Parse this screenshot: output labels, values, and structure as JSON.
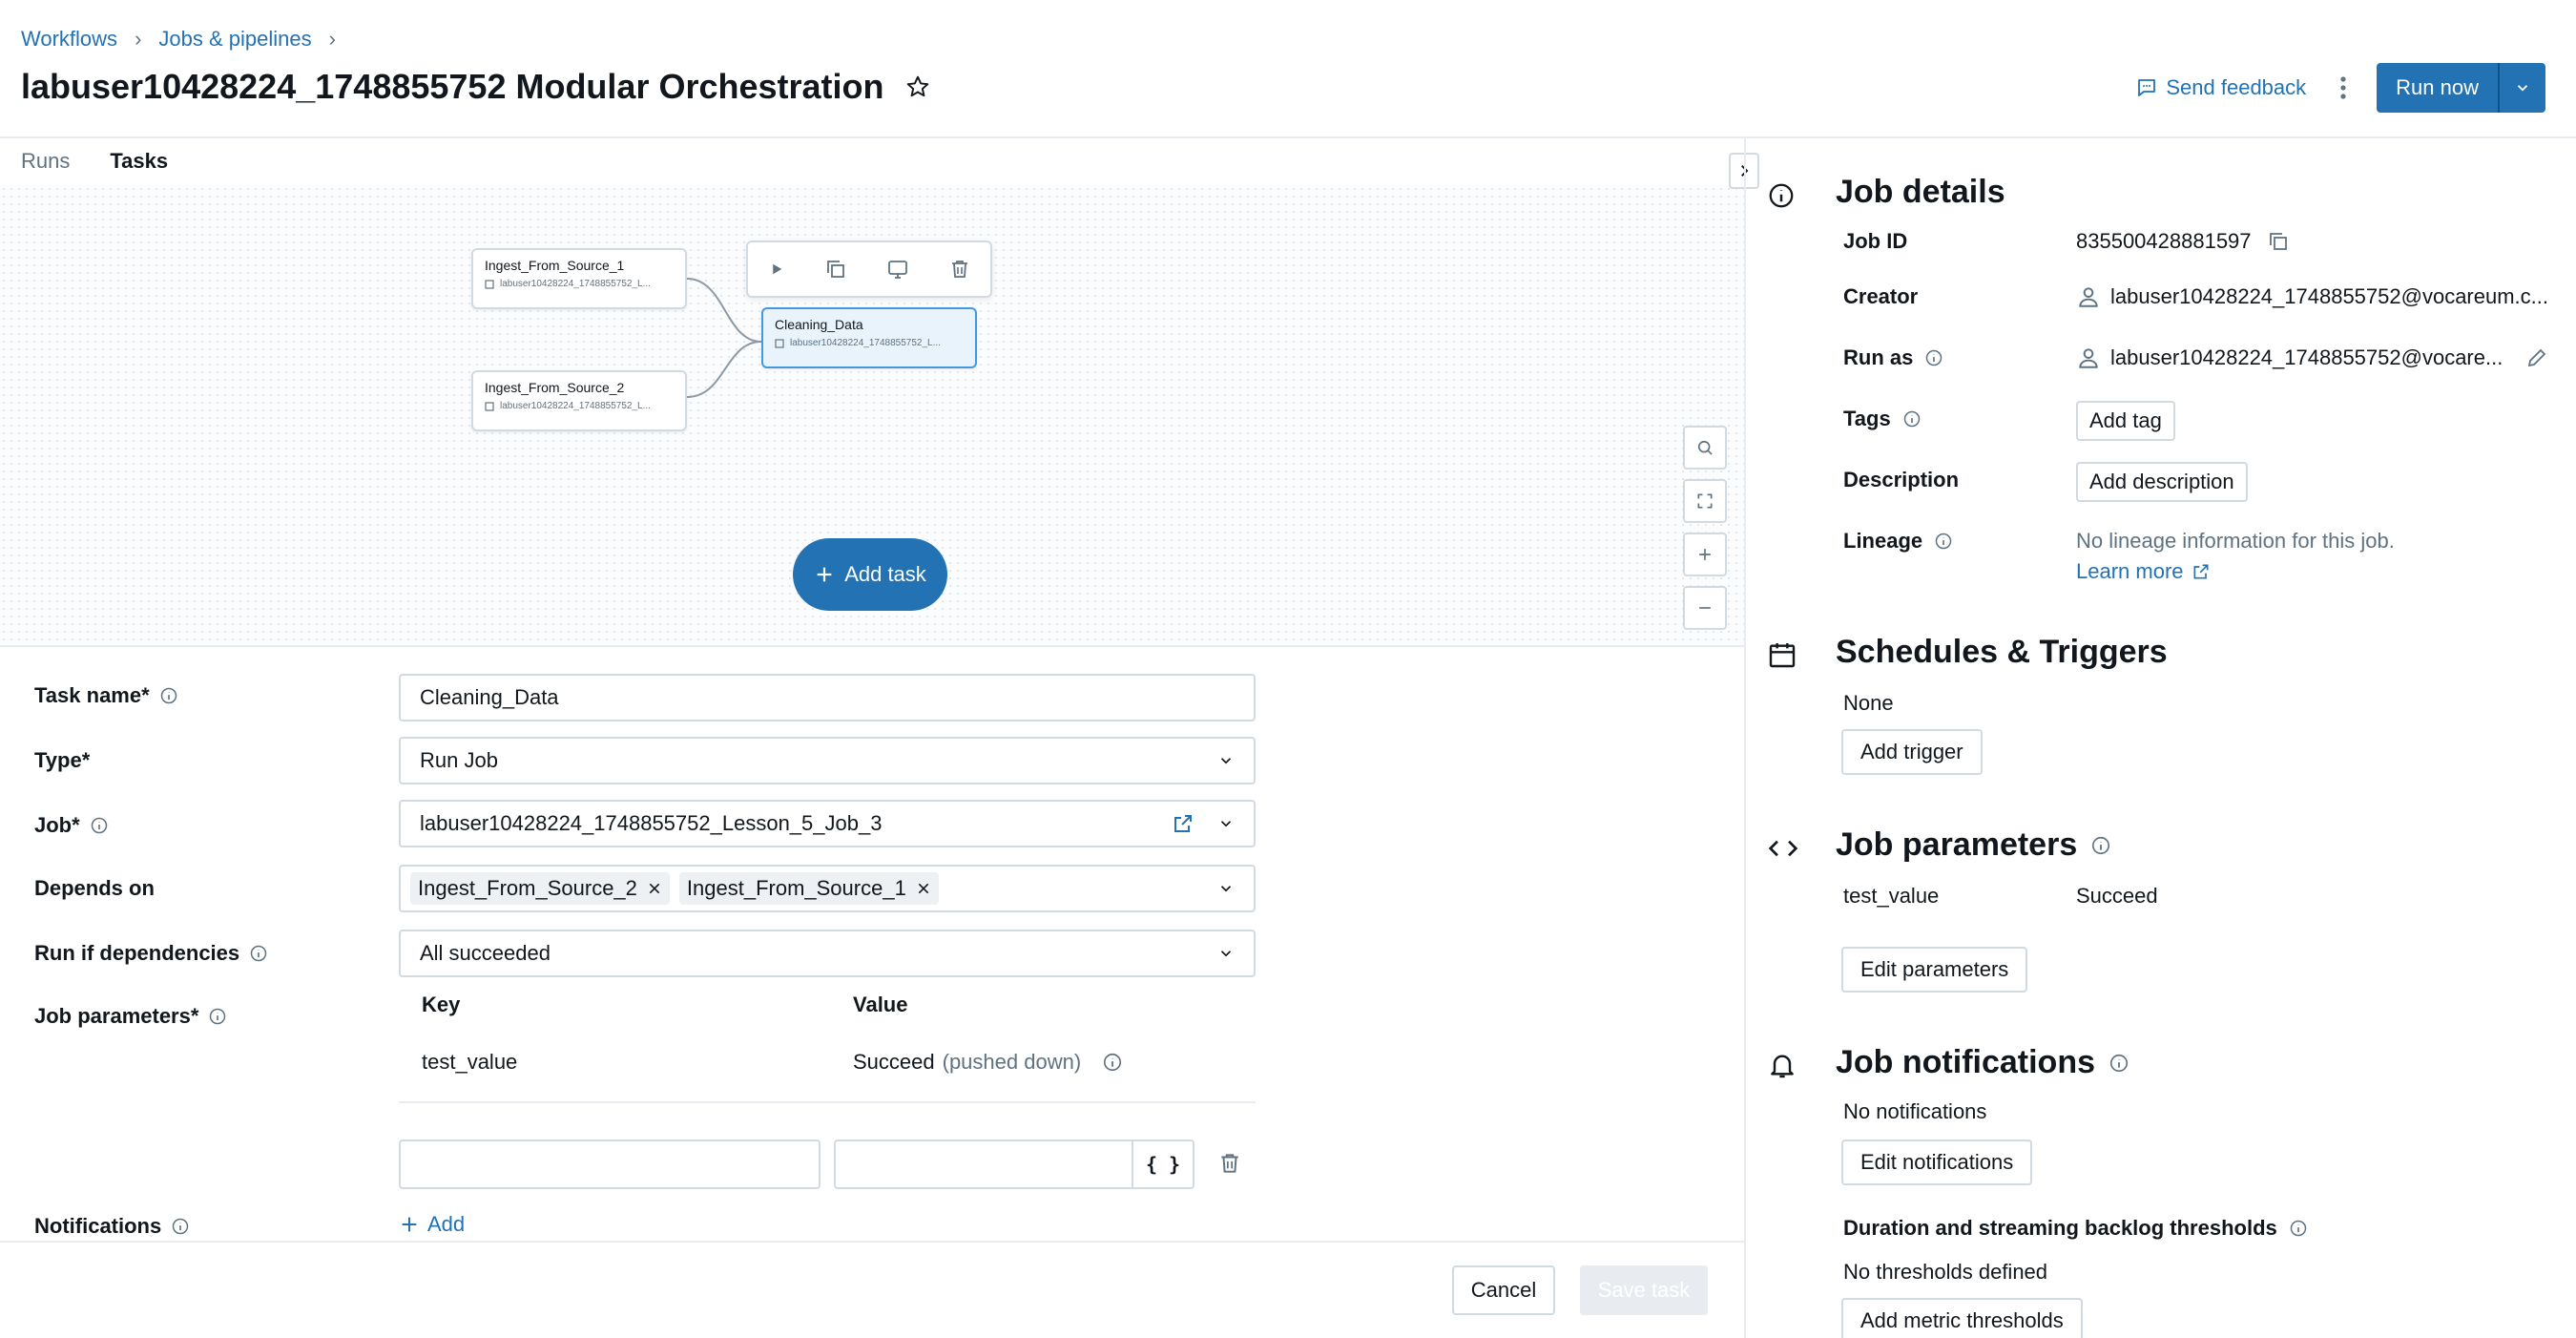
{
  "breadcrumb": {
    "items": [
      "Workflows",
      "Jobs & pipelines"
    ],
    "separator": "›"
  },
  "page": {
    "title": "labuser10428224_1748855752 Modular Orchestration"
  },
  "header": {
    "send_feedback": "Send feedback",
    "run_now": "Run now"
  },
  "tabs": [
    {
      "label": "Runs",
      "active": false
    },
    {
      "label": "Tasks",
      "active": true
    }
  ],
  "graph": {
    "nodes": [
      {
        "name": "Ingest_From_Source_1",
        "sub": "labuser10428224_1748855752_L..."
      },
      {
        "name": "Ingest_From_Source_2",
        "sub": "labuser10428224_1748855752_L..."
      },
      {
        "name": "Cleaning_Data",
        "sub": "labuser10428224_1748855752_L...",
        "selected": true
      }
    ],
    "add_task": "Add task"
  },
  "form": {
    "task_name_label": "Task name*",
    "task_name_value": "Cleaning_Data",
    "type_label": "Type*",
    "type_value": "Run Job",
    "job_label": "Job*",
    "job_value": "labuser10428224_1748855752_Lesson_5_Job_3",
    "depends_on_label": "Depends on",
    "depends_on": [
      "Ingest_From_Source_2",
      "Ingest_From_Source_1"
    ],
    "run_if_label": "Run if dependencies",
    "run_if_value": "All succeeded",
    "job_params_label": "Job parameters*",
    "params_key_header": "Key",
    "params_value_header": "Value",
    "params_rows": [
      {
        "key": "test_value",
        "value": "Succeed",
        "note": "(pushed down)"
      }
    ],
    "brace_label": "{ }",
    "notifications_label": "Notifications",
    "add_label": "Add",
    "cancel": "Cancel",
    "save": "Save task"
  },
  "details": {
    "heading": "Job details",
    "job_id_label": "Job ID",
    "job_id": "835500428881597",
    "creator_label": "Creator",
    "creator": "labuser10428224_1748855752@vocareum.c...",
    "run_as_label": "Run as",
    "run_as": "labuser10428224_1748855752@vocare...",
    "tags_label": "Tags",
    "add_tag": "Add tag",
    "description_label": "Description",
    "add_description": "Add description",
    "lineage_label": "Lineage",
    "lineage_text": "No lineage information for this job.",
    "learn_more": "Learn more"
  },
  "schedules": {
    "heading": "Schedules & Triggers",
    "value": "None",
    "add_trigger": "Add trigger"
  },
  "job_parameters": {
    "heading": "Job parameters",
    "key": "test_value",
    "value": "Succeed",
    "edit": "Edit parameters"
  },
  "notifications": {
    "heading": "Job notifications",
    "value": "No notifications",
    "edit": "Edit notifications",
    "thresholds_label": "Duration and streaming backlog thresholds",
    "thresholds_value": "No thresholds defined",
    "add_thresholds": "Add metric thresholds"
  },
  "colors": {
    "accent": "#2272b4",
    "border": "#d1d9e1",
    "text": "#11171c",
    "muted": "#5f7281",
    "selected_node": "#e8f3fc"
  }
}
